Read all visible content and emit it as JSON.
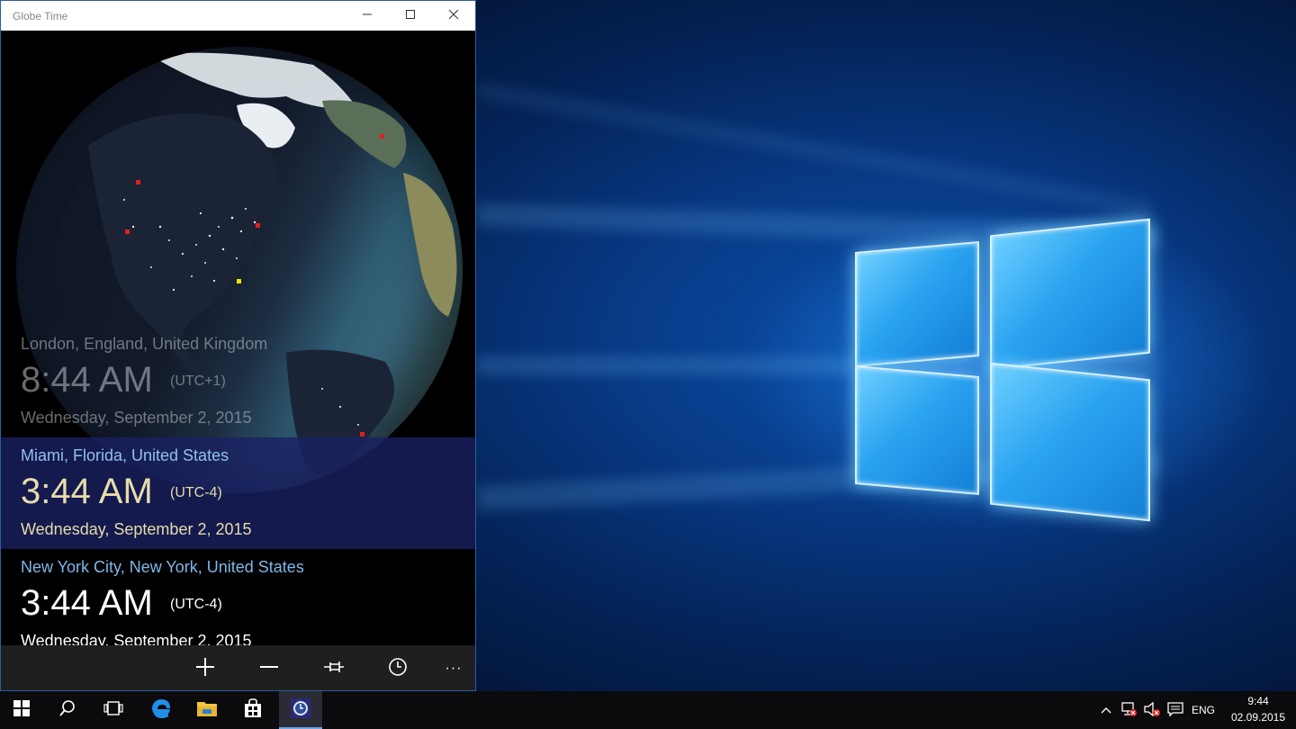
{
  "window": {
    "title": "Globe Time",
    "controls": {
      "minimize": "minimize-icon",
      "maximize": "maximize-icon",
      "close": "close-icon"
    }
  },
  "locations": [
    {
      "city": "London, England, United Kingdom",
      "time": "8:44 AM",
      "utc": "(UTC+1)",
      "date": "Wednesday, September 2, 2015",
      "state": "faded"
    },
    {
      "city": "Miami, Florida, United States",
      "time": "3:44 AM",
      "utc": "(UTC-4)",
      "date": "Wednesday, September 2, 2015",
      "state": "selected"
    },
    {
      "city": "New York City, New York, United States",
      "time": "3:44 AM",
      "utc": "(UTC-4)",
      "date": "Wednesday, September 2, 2015",
      "state": "normal"
    }
  ],
  "appbar": {
    "buttons": [
      "add-icon",
      "remove-icon",
      "pin-icon",
      "clock-icon",
      "more-icon"
    ],
    "more_label": "···"
  },
  "taskbar": {
    "apps": [
      "start-icon",
      "search-icon",
      "task-view-icon",
      "edge-icon",
      "file-explorer-icon",
      "store-icon",
      "globe-time-icon"
    ],
    "tray": {
      "icons": [
        "chevron-up-icon",
        "network-icon",
        "volume-muted-icon",
        "action-center-icon"
      ],
      "language": "ENG",
      "time": "9:44",
      "date": "02.09.2015"
    }
  },
  "colors": {
    "window_border": "#2a5f9e",
    "selected_row": "#19206a",
    "city_text": "#7fb7e6",
    "selected_time_text": "#e6dcaa",
    "taskbar_bg": "#0b0b0e",
    "wallpaper_blue": "#0a4ea8"
  }
}
